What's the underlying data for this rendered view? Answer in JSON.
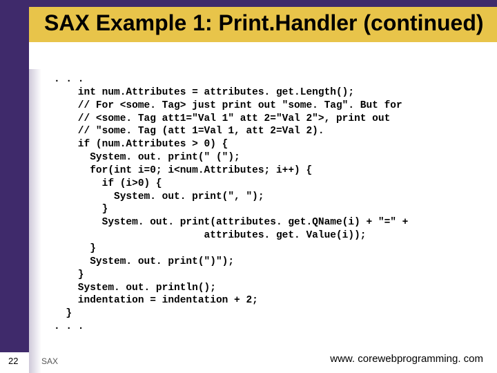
{
  "title": "SAX Example 1: Print.Handler (continued)",
  "code": ". . .\n    int num.Attributes = attributes. get.Length();\n    // For <some. Tag> just print out \"some. Tag\". But for\n    // <some. Tag att1=\"Val 1\" att 2=\"Val 2\">, print out\n    // \"some. Tag (att 1=Val 1, att 2=Val 2).\n    if (num.Attributes > 0) {\n      System. out. print(\" (\");\n      for(int i=0; i<num.Attributes; i++) {\n        if (i>0) {\n          System. out. print(\", \");\n        }\n        System. out. print(attributes. get.QName(i) + \"=\" +\n                         attributes. get. Value(i));\n      }\n      System. out. print(\")\");\n    }\n    System. out. println();\n    indentation = indentation + 2;\n  }\n. . .",
  "slide_number": "22",
  "footer_left": "SAX",
  "footer_right": "www. corewebprogramming. com"
}
